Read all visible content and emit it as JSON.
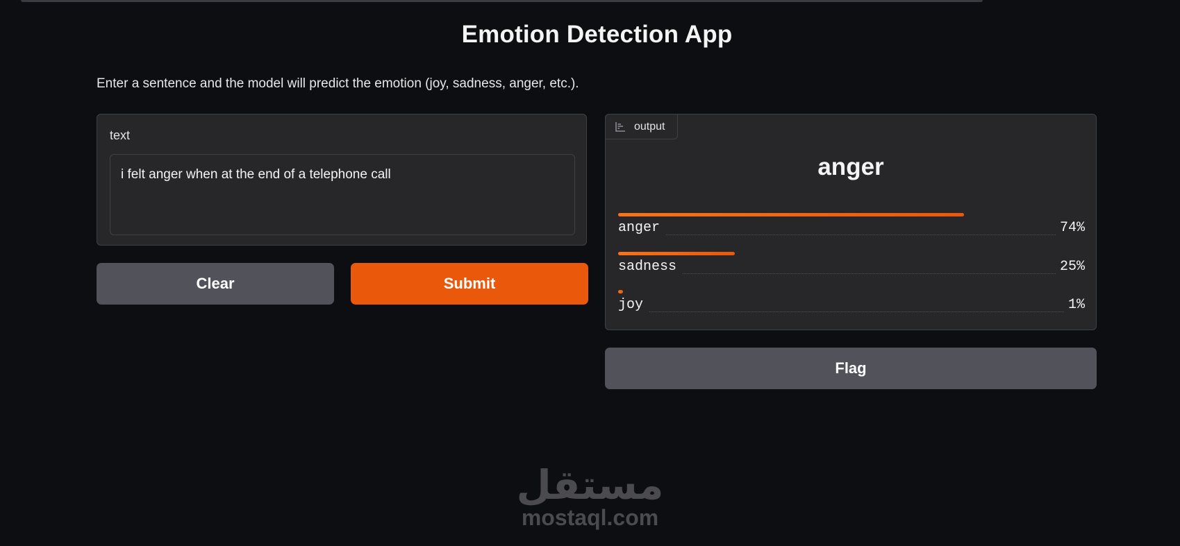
{
  "app": {
    "title": "Emotion Detection App",
    "description": "Enter a sentence and the model will predict the emotion (joy, sadness, anger, etc.)."
  },
  "input": {
    "label": "text",
    "value": "i felt anger when at the end of a telephone call"
  },
  "buttons": {
    "clear": "Clear",
    "submit": "Submit",
    "flag": "Flag"
  },
  "output": {
    "tab_label": "output",
    "tab_icon": "bar-chart-icon",
    "prediction": "anger",
    "confidences": [
      {
        "label": "anger",
        "value": "74%",
        "fraction": 0.74
      },
      {
        "label": "sadness",
        "value": "25%",
        "fraction": 0.25
      },
      {
        "label": "joy",
        "value": "1%",
        "fraction": 0.01
      }
    ]
  },
  "watermark": {
    "arabic": "مستقل",
    "latin": "mostaql.com"
  },
  "colors": {
    "accent": "#ea580c",
    "secondary_button": "#52525b",
    "panel": "#27272a",
    "background": "#0d0e11"
  }
}
